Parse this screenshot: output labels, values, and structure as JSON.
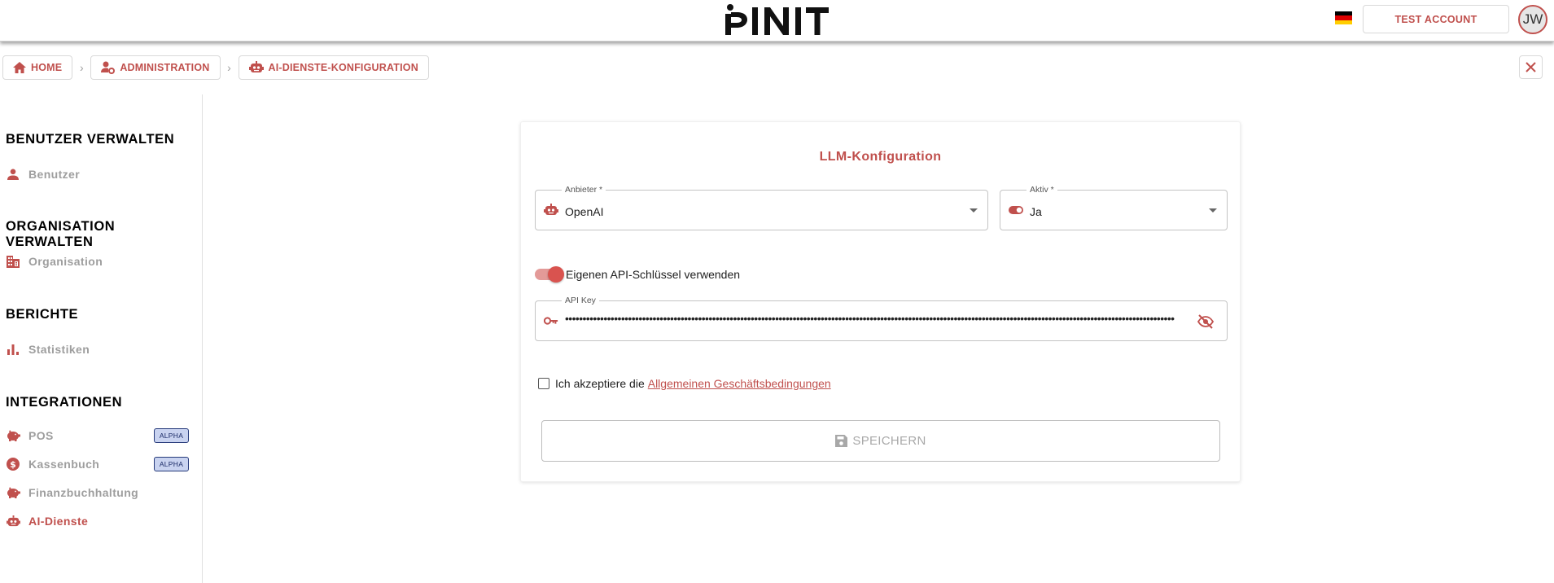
{
  "header": {
    "logo_text": "PINIT",
    "account_label": "TEST ACCOUNT",
    "avatar_initials": "JW",
    "flag": [
      "#000000",
      "#dd0000",
      "#ffce00"
    ]
  },
  "breadcrumb": {
    "items": [
      {
        "label": "HOME",
        "icon": "home-icon"
      },
      {
        "label": "ADMINISTRATION",
        "icon": "admin-icon"
      },
      {
        "label": "AI-DIENSTE-KONFIGURATION",
        "icon": "robot-icon"
      }
    ]
  },
  "sidebar": {
    "sections": [
      {
        "title": "BENUTZER VERWALTEN",
        "items": [
          {
            "label": "Benutzer",
            "icon": "person-icon"
          }
        ]
      },
      {
        "title": "ORGANISATION VERWALTEN",
        "items": [
          {
            "label": "Organisation",
            "icon": "building-icon"
          }
        ]
      },
      {
        "title": "BERICHTE",
        "items": [
          {
            "label": "Statistiken",
            "icon": "bar-chart-icon"
          }
        ]
      },
      {
        "title": "INTEGRATIONEN",
        "items": [
          {
            "label": "POS",
            "icon": "piggy-bank-icon",
            "badge": "ALPHA"
          },
          {
            "label": "Kassenbuch",
            "icon": "dollar-circle-icon",
            "badge": "ALPHA"
          },
          {
            "label": "Finanzbuchhaltung",
            "icon": "piggy-bank-icon"
          },
          {
            "label": "AI-Dienste",
            "icon": "robot-icon",
            "active": true
          }
        ]
      }
    ]
  },
  "form": {
    "title": "LLM-Konfiguration",
    "provider": {
      "label": "Anbieter *",
      "value": "OpenAI",
      "icon": "robot-icon"
    },
    "active": {
      "label": "Aktiv *",
      "value": "Ja",
      "icon": "toggle-icon"
    },
    "own_key_toggle": {
      "label": "Eigenen API-Schlüssel verwenden",
      "checked": true
    },
    "api_key": {
      "label": "API Key",
      "value": "••••••••••••••••••••••••••••••••••••••••••••••••••••••••••••••••••••••••••••••••••••••••••••••••••••••••••••••••••••••••••••••••••••••••••••••••••••••••••••••••••••••••••••••"
    },
    "terms": {
      "prefix": "Ich akzeptiere die",
      "link": "Allgemeinen Geschäftsbedingungen",
      "checked": false
    },
    "save_label": "SPEICHERN"
  },
  "colors": {
    "accent": "#c0504d",
    "muted": "#9e9e9e",
    "badge_bg": "#c9d3f0"
  }
}
